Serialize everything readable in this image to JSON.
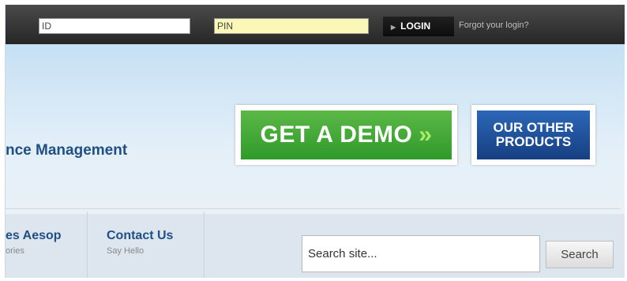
{
  "login": {
    "id_value": "ID",
    "pin_value": "PIN",
    "login_label": "LOGIN",
    "forgot_label": "Forgot your login?"
  },
  "hero": {
    "title": "nce Management",
    "demo_label": "GET A DEMO",
    "demo_chevrons": "»",
    "products_line1": "OUR OTHER",
    "products_line2": "PRODUCTS"
  },
  "nav": {
    "items": [
      {
        "label": "es Aesop",
        "sub": "ories"
      },
      {
        "label": "Contact Us",
        "sub": "Say Hello"
      }
    ]
  },
  "search": {
    "placeholder": "Search site...",
    "button_label": "Search"
  },
  "colors": {
    "topbar": "#333333",
    "pin_field": "#fbf7b7",
    "demo_green": "#46a83a",
    "products_blue": "#1f4f96",
    "nav_text": "#1f4f84"
  }
}
